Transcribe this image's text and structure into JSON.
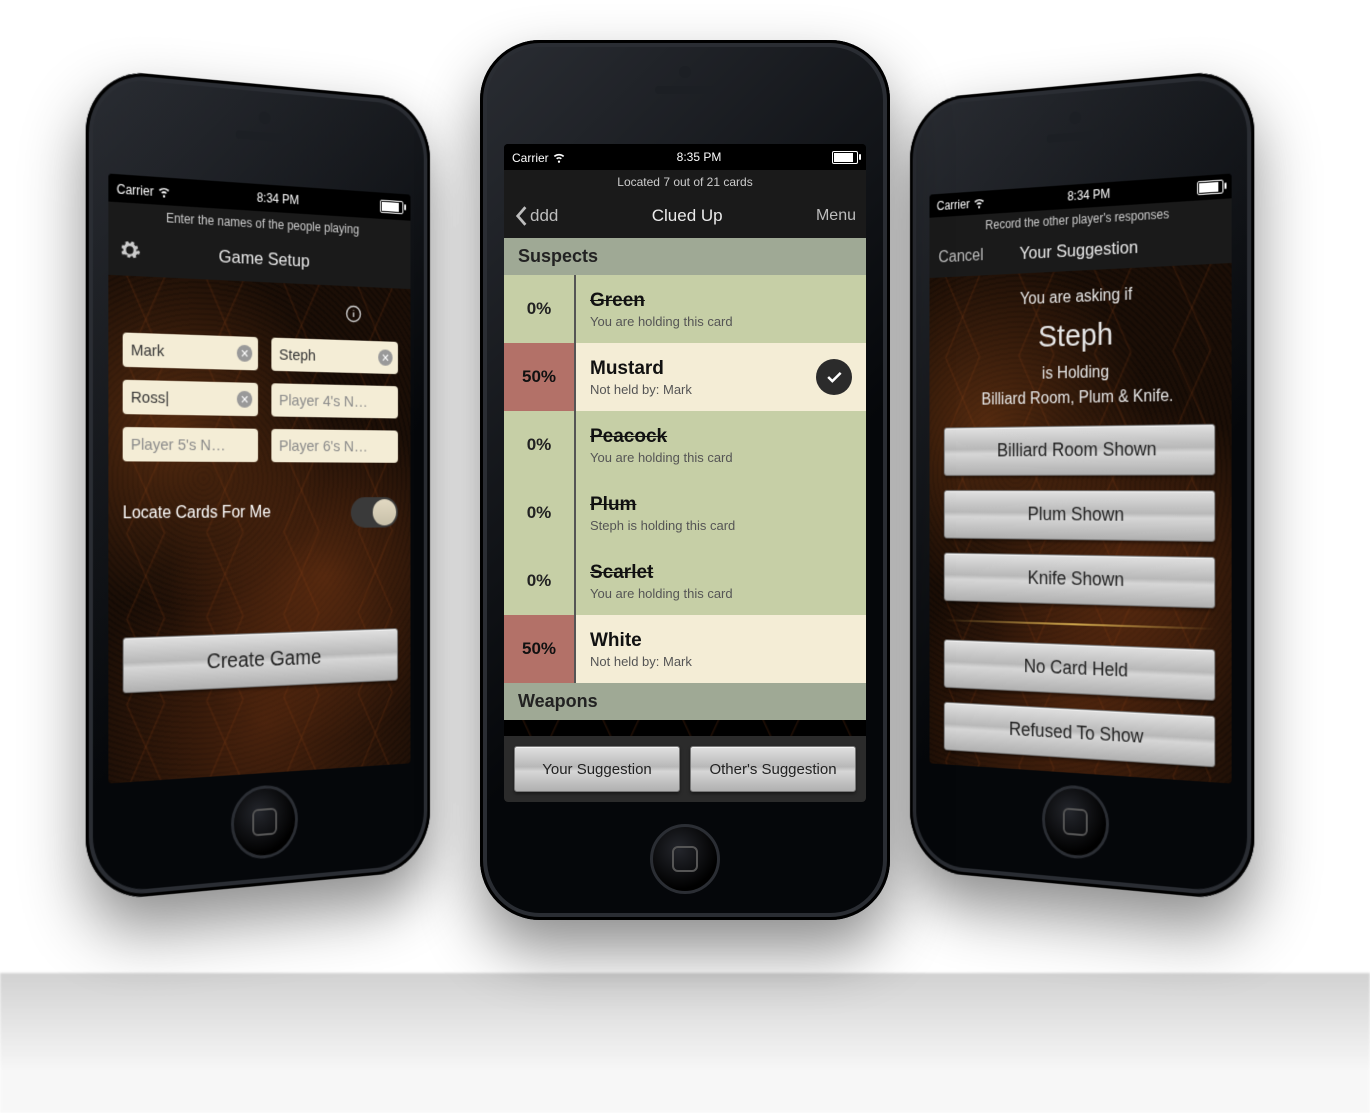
{
  "shared": {
    "carrier": "Carrier",
    "wifi_icon": "wifi"
  },
  "left": {
    "time": "8:34 PM",
    "hint": "Enter the names of the people playing",
    "title": "Game Setup",
    "info_icon": "info",
    "players": {
      "p1": {
        "value": "Mark"
      },
      "p2": {
        "value": "Steph"
      },
      "p3": {
        "value": "Ross|"
      },
      "p4": {
        "placeholder": "Player 4's N…"
      },
      "p5": {
        "placeholder": "Player 5's N…"
      },
      "p6": {
        "placeholder": "Player 6's N…"
      }
    },
    "locate_label": "Locate Cards For Me",
    "locate_on": true,
    "create": "Create Game"
  },
  "center": {
    "time": "8:35 PM",
    "progress": "Located 7 out of 21 cards",
    "back": "ddd",
    "title": "Clued Up",
    "menu": "Menu",
    "section": "Suspects",
    "next_section": "Weapons",
    "rows": [
      {
        "pct": "0%",
        "name": "Green",
        "sub": "You are holding this card",
        "variant": "green",
        "strike": true
      },
      {
        "pct": "50%",
        "name": "Mustard",
        "sub": "Not held by: Mark",
        "variant": "red",
        "strike": false,
        "checked": true
      },
      {
        "pct": "0%",
        "name": "Peacock",
        "sub": "You are holding this card",
        "variant": "green",
        "strike": true
      },
      {
        "pct": "0%",
        "name": "Plum",
        "sub": "Steph is holding this card",
        "variant": "green",
        "strike": true
      },
      {
        "pct": "0%",
        "name": "Scarlet",
        "sub": "You are holding this card",
        "variant": "green",
        "strike": true
      },
      {
        "pct": "50%",
        "name": "White",
        "sub": "Not held by: Mark",
        "variant": "red",
        "strike": false
      }
    ],
    "your_sugg": "Your Suggestion",
    "other_sugg": "Other's Suggestion"
  },
  "right": {
    "time": "8:34 PM",
    "hint": "Record the other player's responses",
    "cancel": "Cancel",
    "title": "Your Suggestion",
    "ask_prefix": "You are asking if",
    "who": "Steph",
    "holding": "is Holding",
    "cards": "Billiard Room, Plum & Knife.",
    "buttons": {
      "b1": "Billiard Room Shown",
      "b2": "Plum Shown",
      "b3": "Knife Shown",
      "b4": "No Card Held",
      "b5": "Refused To Show"
    }
  }
}
